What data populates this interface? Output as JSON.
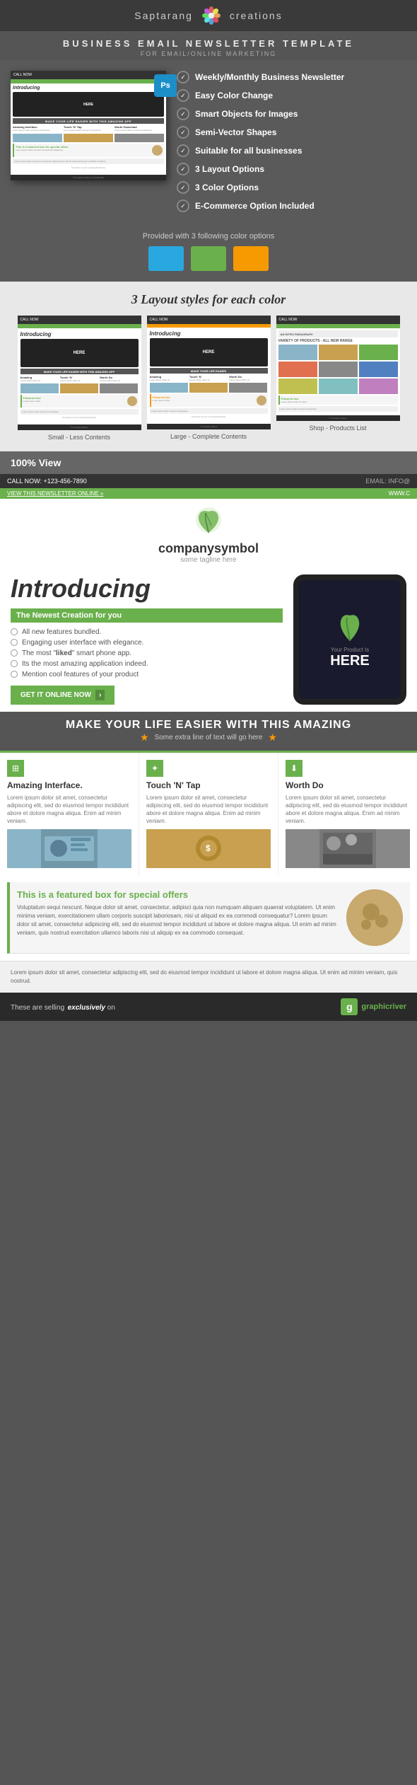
{
  "header": {
    "brand_left": "Saptarang",
    "brand_right": "creations"
  },
  "title_bar": {
    "main": "BUSINESS EMAIL NEWSLETTER TEMPLATE",
    "sub": "FOR EMAIL/ONLINE MARKETING"
  },
  "features": {
    "list": [
      "Weekly/Monthly Business Newsletter",
      "Easy Color Change",
      "Smart Objects for Images",
      "Semi-Vector Shapes",
      "Suitable for all businesses",
      "3 Layout Options",
      "3 Color Options",
      "E-Commerce Option Included"
    ]
  },
  "color_section": {
    "label": "Provided with 3 following color options",
    "colors": [
      "#29a8e0",
      "#6ab04c",
      "#f59a00"
    ]
  },
  "layout_section": {
    "title": "3 Layout styles for each color",
    "captions": [
      "Small - Less Contents",
      "Large - Complete Contents",
      "Shop - Products List"
    ]
  },
  "view_section": {
    "label": "100% View"
  },
  "newsletter": {
    "call_now": "CALL NOW: +123-456-7890",
    "email_label": "EMAIL: INFO@",
    "view_online": "VIEW THIS NEWSLETTER ONLINE »",
    "website": "WWW.C",
    "company_name": "companysymbol",
    "tagline": "some tagline here",
    "introducing": "Introducing",
    "subtitle": "The Newest Creation for you",
    "bullets": [
      "All new features bundled.",
      "Engaging user interface with elegance.",
      "The most \"liked\" smart phone app.",
      "Its the most amazing application indeed.",
      "Mention cool features of your product"
    ],
    "cta": "GET IT ONLINE NOW",
    "product_label": "Your Product Is",
    "here_text": "HERE",
    "banner_title": "MAKE YOUR LIFE EASIER WITH THIS AMAZING",
    "banner_sub": "Some extra line of text will go here",
    "features": [
      {
        "title": "Amazing Interface.",
        "body": "Lorem ipsum dolor sit amet, consectetur adipiscing elit, sed do eiusmod tempor incididunt abore et dolore magna aliqua. Enim ad minim veniam.",
        "img_color": "#8ab5c8"
      },
      {
        "title": "Touch 'N' Tap",
        "body": "Lorem ipsum dolor sit amet, consectetur adipiscing elit, sed do eiusmod tempor incididunt abore et dolore magna aliqua. Enim ad minim veniam.",
        "img_color": "#c8a050"
      },
      {
        "title": "Worth Do",
        "body": "Lorem ipsum dolor sit amet, consectetur adipiscing elit, sed do eiusmod tempor incididunt abore et dolore magna aliqua. Enim ad minim veniam.",
        "img_color": "#888"
      }
    ],
    "featured_title": "This is a featured box for special offers",
    "featured_body": "Voluptatum sequi nescunt. Neque dolor sit amet, consectetur, adipisci quia non numquam aliquam quaerat voluptatem. Ut enim minima veniam, exercitationem ullam corporis suscipit laboriosam, nisi ut aliquid ex ea commodi consequatur? Lorem ipsum dolor sit amet, consectetur adipiscing elit, sed do eiusmod tempor incididunt ut labore et dolore magna aliqua. Ut enim ad minim veniam, quis nostrud exercitation ullamco laboris nisi ut aliquip ex ea commodo consequat.",
    "lorem_body": "Lorem ipsum dolor sit amet, consectetur adipiscing elit, sed do eiusmod tempor incididunt ut labore et dolore magna aliqua. Ut enim ad minim veniam, quis nostrud.",
    "selling_text_prefix": "These are selling",
    "selling_bold": "exclusively",
    "selling_suffix": "on",
    "gr_label": "graphicriver"
  },
  "ps_badge": "Ps"
}
